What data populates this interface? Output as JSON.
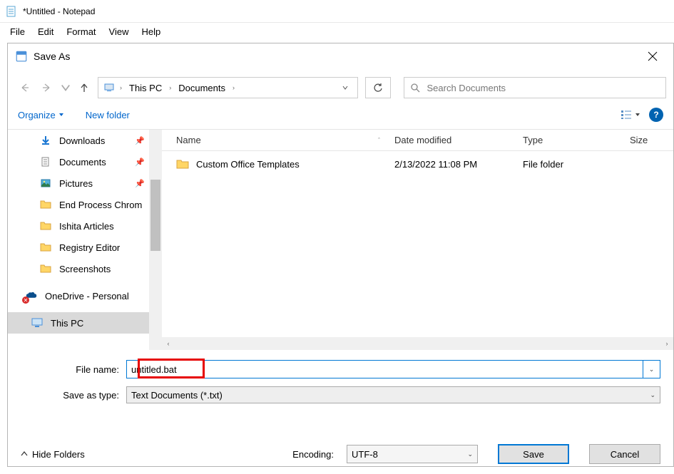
{
  "notepad": {
    "title": "*Untitled - Notepad",
    "menu": {
      "file": "File",
      "edit": "Edit",
      "format": "Format",
      "view": "View",
      "help": "Help"
    }
  },
  "dialog": {
    "title": "Save As",
    "breadcrumb": {
      "root": "This PC",
      "folder": "Documents"
    },
    "search_placeholder": "Search Documents",
    "organize": "Organize",
    "new_folder": "New folder",
    "sidebar": {
      "items": [
        {
          "label": "Downloads",
          "pinned": true
        },
        {
          "label": "Documents",
          "pinned": true
        },
        {
          "label": "Pictures",
          "pinned": true
        },
        {
          "label": "End Process Chrom",
          "pinned": false
        },
        {
          "label": "Ishita Articles",
          "pinned": false
        },
        {
          "label": "Registry Editor",
          "pinned": false
        },
        {
          "label": "Screenshots",
          "pinned": false
        }
      ],
      "onedrive": "OneDrive - Personal",
      "thispc": "This PC"
    },
    "columns": {
      "name": "Name",
      "date": "Date modified",
      "type": "Type",
      "size": "Size"
    },
    "rows": [
      {
        "name": "Custom Office Templates",
        "date": "2/13/2022 11:08 PM",
        "type": "File folder"
      }
    ],
    "filename_label": "File name:",
    "filename_value": "untitled.bat",
    "savetype_label": "Save as type:",
    "savetype_value": "Text Documents (*.txt)",
    "hide_folders": "Hide Folders",
    "encoding_label": "Encoding:",
    "encoding_value": "UTF-8",
    "save_btn": "Save",
    "cancel_btn": "Cancel"
  }
}
